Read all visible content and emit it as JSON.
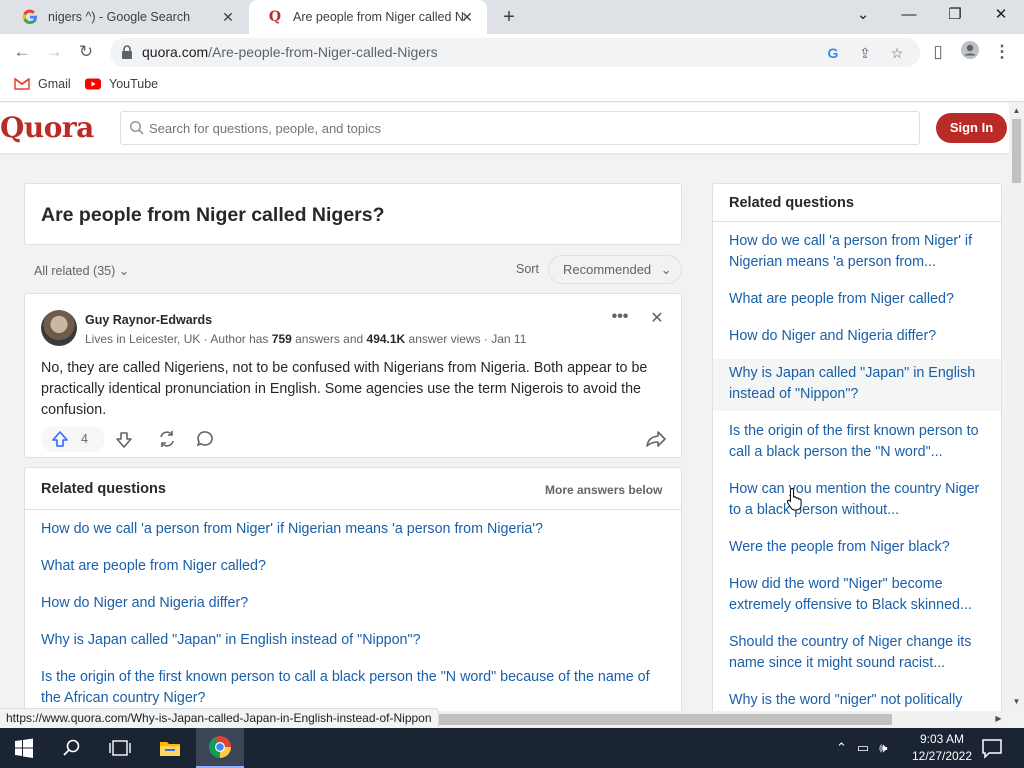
{
  "browser": {
    "tabs": [
      {
        "title": "nigers ^) - Google Search",
        "favicon": "google-g-icon",
        "active": false
      },
      {
        "title": "Are people from Niger called Nig",
        "favicon": "quora-q-icon",
        "active": true
      }
    ],
    "url": {
      "host": "quora.com",
      "path": "/Are-people-from-Niger-called-Nigers"
    },
    "bookmarks": [
      {
        "label": "Gmail",
        "icon": "gmail-icon"
      },
      {
        "label": "YouTube",
        "icon": "youtube-icon"
      }
    ],
    "status_url": "https://www.quora.com/Why-is-Japan-called-Japan-in-English-instead-of-Nippon"
  },
  "header": {
    "logo": "Quora",
    "search_placeholder": "Search for questions, people, and topics",
    "signin_label": "Sign In"
  },
  "question": {
    "title": "Are people from Niger called Nigers?",
    "all_related": "All related (35)",
    "sort_label": "Sort",
    "sort_value": "Recommended"
  },
  "answer": {
    "author": "Guy Raynor-Edwards",
    "credential_prefix": "Lives in Leicester, UK · Author has ",
    "answers_count": "759",
    "credential_mid": " answers and ",
    "views_count": "494.1K",
    "credential_suffix": " answer views · Jan 11",
    "text": "No, they are called Nigeriens, not to be confused with Nigerians from Nigeria. Both appear to be practically identical pronunciation in English. Some agencies use the term Nigerois to avoid the confusion.",
    "upvotes": "4"
  },
  "related_main": {
    "heading": "Related questions",
    "more": "More answers below",
    "items": [
      "How do we call 'a person from Niger' if Nigerian means 'a person from Nigeria'?",
      "What are people from Niger called?",
      "How do Niger and Nigeria differ?",
      "Why is Japan called \"Japan\" in English instead of \"Nippon\"?",
      "Is the origin of the first known person to call a black person the \"N word\" because of the name of the African country Niger?"
    ]
  },
  "related_side": {
    "heading": "Related questions",
    "items": [
      "How do we call 'a person from Niger' if Nigerian means 'a person from...",
      "What are people from Niger called?",
      "How do Niger and Nigeria differ?",
      "Why is Japan called \"Japan\" in English instead of \"Nippon\"?",
      "Is the origin of the first known person to call a black person the \"N word\"...",
      "How can you mention the country Niger to a black person without...",
      "Were the people from Niger black?",
      "How did the word \"Niger\" become extremely offensive to Black skinned...",
      "Should the country of Niger change its name since it might sound racist...",
      "Why is the word \"niger\" not politically"
    ]
  },
  "taskbar": {
    "time": "9:03 AM",
    "date": "12/27/2022"
  },
  "colors": {
    "quora_red": "#b92b27",
    "link_blue": "#195faa",
    "text_dark": "#282829",
    "text_muted": "#636466"
  }
}
